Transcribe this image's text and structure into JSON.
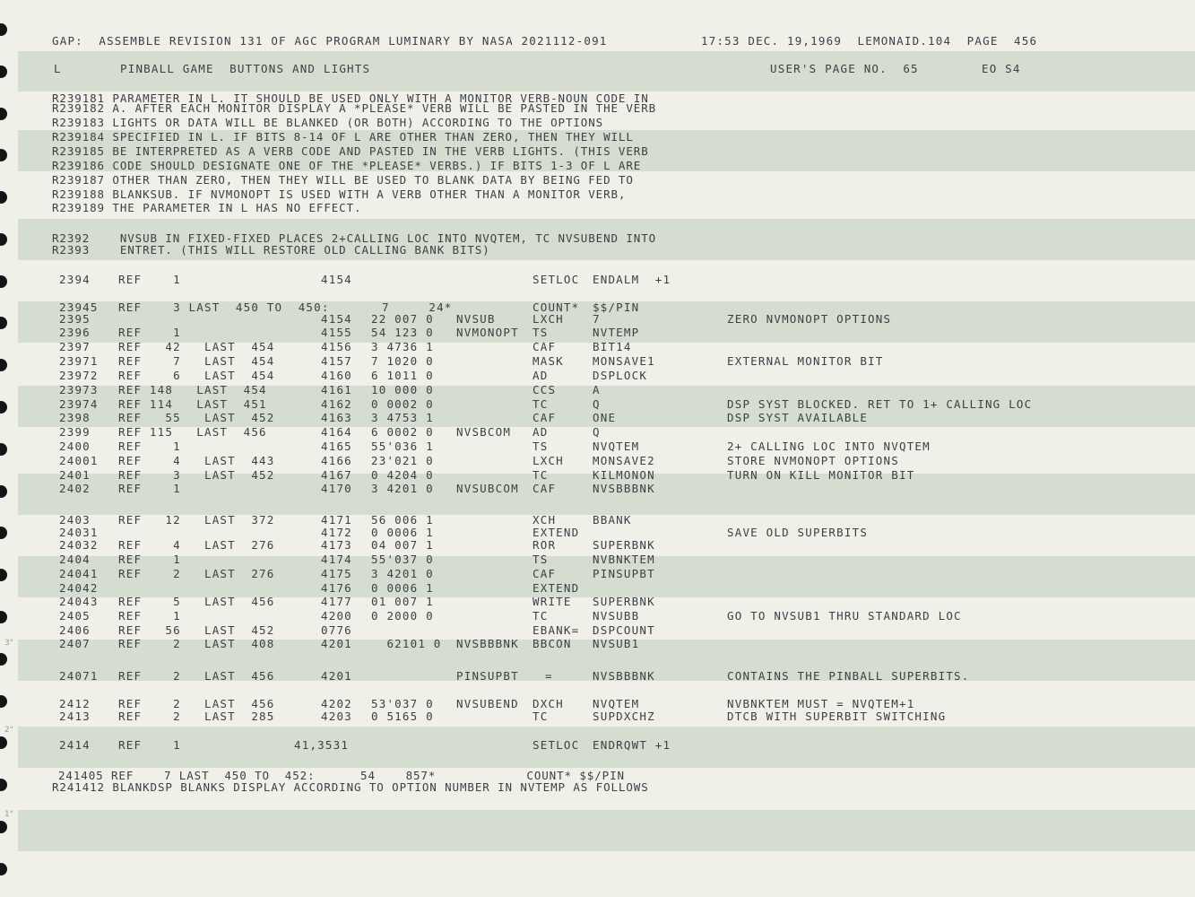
{
  "header": {
    "left": "GAP:  ASSEMBLE REVISION 131 OF AGC PROGRAM LUMINARY BY NASA 2021112-091",
    "right": "17:53 DEC. 19,1969  LEMONAID.104  PAGE  456"
  },
  "subheader": {
    "label": "L",
    "title": "PINBALL GAME  BUTTONS AND LIGHTS",
    "users_page": "USER'S PAGE NO.  65",
    "code": "EO S4"
  },
  "comment_block_1": [
    "R239181 PARAMETER IN L. IT SHOULD BE USED ONLY WITH A MONITOR VERB-NOUN CODE IN",
    "R239182 A. AFTER EACH MONITOR DISPLAY A *PLEASE* VERB WILL BE PASTED IN THE VERB",
    "R239183 LIGHTS OR DATA WILL BE BLANKED (OR BOTH) ACCORDING TO THE OPTIONS",
    "R239184 SPECIFIED IN L. IF BITS 8-14 OF L ARE OTHER THAN ZERO, THEN THEY WILL",
    "R239185 BE INTERPRETED AS A VERB CODE AND PASTED IN THE VERB LIGHTS. (THIS VERB",
    "R239186 CODE SHOULD DESIGNATE ONE OF THE *PLEASE* VERBS.) IF BITS 1-3 OF L ARE",
    "R239187 OTHER THAN ZERO, THEN THEY WILL BE USED TO BLANK DATA BY BEING FED TO",
    "R239188 BLANKSUB. IF NVMONOPT IS USED WITH A VERB OTHER THAN A MONITOR VERB,",
    "R239189 THE PARAMETER IN L HAS NO EFFECT."
  ],
  "comment_block_2": [
    "R2392    NVSUB IN FIXED-FIXED PLACES 2+CALLING LOC INTO NVQTEM, TC NVSUBEND INTO",
    "R2393    ENTRET. (THIS WILL RESTORE OLD CALLING BANK BITS)"
  ],
  "rows": [
    {
      "seq": "2394",
      "ref": "REF    1",
      "addr": "4154",
      "word": "",
      "tag": "",
      "op": "SETLOC",
      "operand": "ENDALM  +1",
      "comment": ""
    },
    {
      "seq": "23945",
      "ref": "REF    3 LAST  450 TO  450:",
      "addr": "",
      "word": "7     24*",
      "tag": "",
      "op": "COUNT*",
      "operand": "$$/PIN",
      "comment": ""
    },
    {
      "seq": "2395",
      "ref": "",
      "addr": "4154",
      "word": "22 007 0",
      "tag": "NVSUB",
      "op": "LXCH",
      "operand": "7",
      "comment": "ZERO NVMONOPT OPTIONS"
    },
    {
      "seq": "2396",
      "ref": "REF    1",
      "addr": "4155",
      "word": "54 123 0",
      "tag": "NVMONOPT",
      "op": "TS",
      "operand": "NVTEMP",
      "comment": ""
    },
    {
      "seq": "2397",
      "ref": "REF   42   LAST  454",
      "addr": "4156",
      "word": "3 4736 1",
      "tag": "",
      "op": "CAF",
      "operand": "BIT14",
      "comment": ""
    },
    {
      "seq": "23971",
      "ref": "REF    7   LAST  454",
      "addr": "4157",
      "word": "7 1020 0",
      "tag": "",
      "op": "MASK",
      "operand": "MONSAVE1",
      "comment": "EXTERNAL MONITOR BIT"
    },
    {
      "seq": "23972",
      "ref": "REF    6   LAST  454",
      "addr": "4160",
      "word": "6 1011 0",
      "tag": "",
      "op": "AD",
      "operand": "DSPLOCK",
      "comment": ""
    },
    {
      "seq": "23973",
      "ref": "REF 148   LAST  454",
      "addr": "4161",
      "word": "10 000 0",
      "tag": "",
      "op": "CCS",
      "operand": "A",
      "comment": ""
    },
    {
      "seq": "23974",
      "ref": "REF 114   LAST  451",
      "addr": "4162",
      "word": "0 0002 0",
      "tag": "",
      "op": "TC",
      "operand": "Q",
      "comment": "DSP SYST BLOCKED. RET TO 1+ CALLING LOC"
    },
    {
      "seq": "2398",
      "ref": "REF   55   LAST  452",
      "addr": "4163",
      "word": "3 4753 1",
      "tag": "",
      "op": "CAF",
      "operand": "ONE",
      "comment": "DSP SYST AVAILABLE"
    },
    {
      "seq": "2399",
      "ref": "REF 115   LAST  456",
      "addr": "4164",
      "word": "6 0002 0",
      "tag": "NVSBCOM",
      "op": "AD",
      "operand": "Q",
      "comment": ""
    },
    {
      "seq": "2400",
      "ref": "REF    1",
      "addr": "4165",
      "word": "55'036 1",
      "tag": "",
      "op": "TS",
      "operand": "NVQTEM",
      "comment": "2+ CALLING LOC INTO NVQTEM"
    },
    {
      "seq": "24001",
      "ref": "REF    4   LAST  443",
      "addr": "4166",
      "word": "23'021 0",
      "tag": "",
      "op": "LXCH",
      "operand": "MONSAVE2",
      "comment": "STORE NVMONOPT OPTIONS"
    },
    {
      "seq": "2401",
      "ref": "REF    3   LAST  452",
      "addr": "4167",
      "word": "0 4204 0",
      "tag": "",
      "op": "TC",
      "operand": "KILMONON",
      "comment": "TURN ON KILL MONITOR BIT"
    },
    {
      "seq": "2402",
      "ref": "REF    1",
      "addr": "4170",
      "word": "3 4201 0",
      "tag": "NVSUBCOM",
      "op": "CAF",
      "operand": "NVSBBBNK",
      "comment": ""
    },
    {
      "seq": "2403",
      "ref": "REF   12   LAST  372",
      "addr": "4171",
      "word": "56 006 1",
      "tag": "",
      "op": "XCH",
      "operand": "BBANK",
      "comment": ""
    },
    {
      "seq": "24031",
      "ref": "",
      "addr": "4172",
      "word": "0 0006 1",
      "tag": "",
      "op": "EXTEND",
      "operand": "",
      "comment": "SAVE OLD SUPERBITS"
    },
    {
      "seq": "24032",
      "ref": "REF    4   LAST  276",
      "addr": "4173",
      "word": "04 007 1",
      "tag": "",
      "op": "ROR",
      "operand": "SUPERBNK",
      "comment": ""
    },
    {
      "seq": "2404",
      "ref": "REF    1",
      "addr": "4174",
      "word": "55'037 0",
      "tag": "",
      "op": "TS",
      "operand": "NVBNKTEM",
      "comment": ""
    },
    {
      "seq": "24041",
      "ref": "REF    2   LAST  276",
      "addr": "4175",
      "word": "3 4201 0",
      "tag": "",
      "op": "CAF",
      "operand": "PINSUPBT",
      "comment": ""
    },
    {
      "seq": "24042",
      "ref": "",
      "addr": "4176",
      "word": "0 0006 1",
      "tag": "",
      "op": "EXTEND",
      "operand": "",
      "comment": ""
    },
    {
      "seq": "24043",
      "ref": "REF    5   LAST  456",
      "addr": "4177",
      "word": "01 007 1",
      "tag": "",
      "op": "WRITE",
      "operand": "SUPERBNK",
      "comment": ""
    },
    {
      "seq": "2405",
      "ref": "REF    1",
      "addr": "4200",
      "word": "0 2000 0",
      "tag": "",
      "op": "TC",
      "operand": "NVSUBB",
      "comment": "GO TO NVSUB1 THRU STANDARD LOC"
    },
    {
      "seq": "2406",
      "ref": "REF   56   LAST  452",
      "addr": "0776",
      "word": "",
      "tag": "",
      "op": "EBANK=",
      "operand": "DSPCOUNT",
      "comment": ""
    },
    {
      "seq": "2407",
      "ref": "REF    2   LAST  408",
      "addr": "4201",
      "word": "  62101 0",
      "tag": "NVSBBBNK",
      "op": "BBCON",
      "operand": "NVSUB1",
      "comment": ""
    },
    {
      "seq": "24071",
      "ref": "REF    2   LAST  456",
      "addr": "4201",
      "word": "",
      "tag": "PINSUPBT",
      "op": "=",
      "operand": "NVSBBBNK",
      "comment": "CONTAINS THE PINBALL SUPERBITS."
    },
    {
      "seq": "2412",
      "ref": "REF    2   LAST  456",
      "addr": "4202",
      "word": "53'037 0",
      "tag": "NVSUBEND",
      "op": "DXCH",
      "operand": "NVQTEM",
      "comment": "NVBNKTEM MUST = NVQTEM+1"
    },
    {
      "seq": "2413",
      "ref": "REF    2   LAST  285",
      "addr": "4203",
      "word": "0 5165 0",
      "tag": "",
      "op": "TC",
      "operand": "SUPDXCHZ",
      "comment": "DTCB WITH SUPERBIT SWITCHING"
    },
    {
      "seq": "2414",
      "ref": "REF    1",
      "addr": "41,3531",
      "word": "",
      "tag": "",
      "op": "SETLOC",
      "operand": "ENDRQWT +1",
      "comment": ""
    }
  ],
  "footer_lines": [
    "241405 REF    7 LAST  450 TO  452:      54    857*            COUNT* $$/PIN",
    "R241412 BLANKDSP BLANKS DISPLAY ACCORDING TO OPTION NUMBER IN NVTEMP AS FOLLOWS"
  ],
  "ruler_marks": [
    "3\"",
    "2\"",
    "1\""
  ]
}
